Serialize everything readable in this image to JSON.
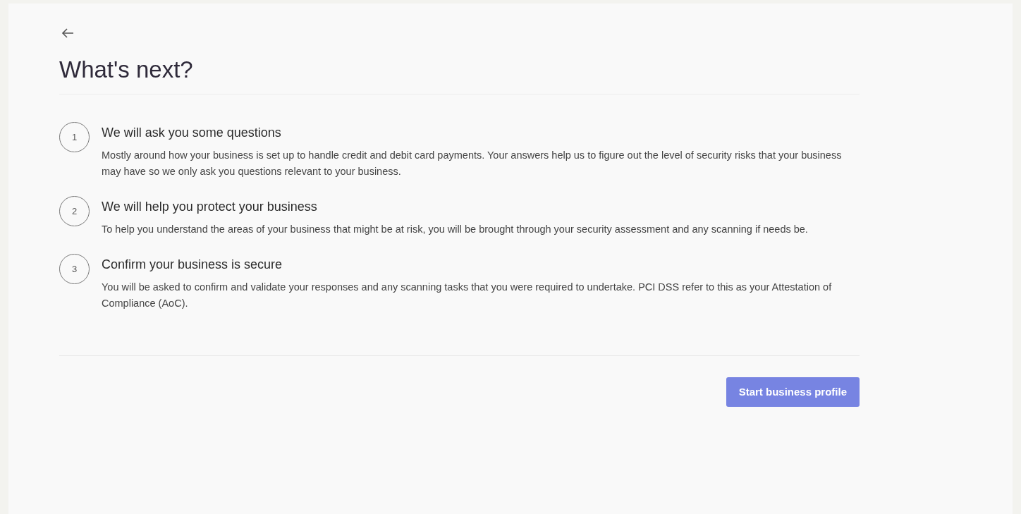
{
  "title": "What's next?",
  "steps": [
    {
      "number": "1",
      "heading": "We will ask you some questions",
      "text": "Mostly around how your business is set up to handle credit and debit card payments. Your answers help us to figure out the level of security risks that your business may have so we only ask you questions relevant to your business."
    },
    {
      "number": "2",
      "heading": "We will help you protect your business",
      "text": "To help you understand the areas of your business that might be at risk, you will be brought through your security assessment and any scanning if needs be."
    },
    {
      "number": "3",
      "heading": "Confirm your business is secure",
      "text": "You will be asked to confirm and validate your responses and any scanning tasks that you were required to undertake. PCI DSS refer to this as your Attestation of Compliance (AoC)."
    }
  ],
  "button": "Start business profile"
}
